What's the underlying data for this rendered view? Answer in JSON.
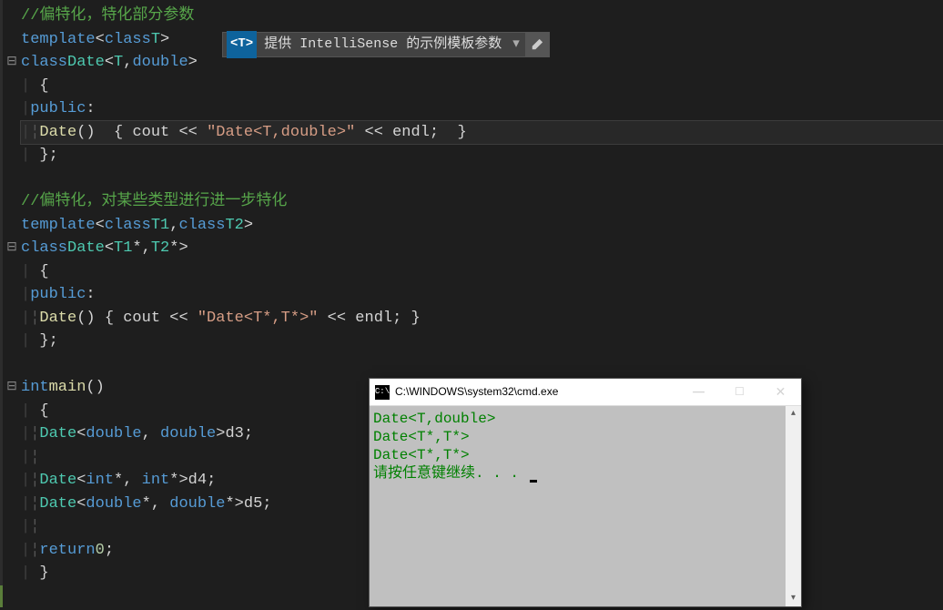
{
  "code": {
    "comment1": "//偏特化，特化部分参数",
    "l2_template": "template",
    "l2_class": "class",
    "l2_T": "T",
    "l3_class": "class",
    "l3_Date": "Date",
    "l3_T": "T",
    "l3_double": "double",
    "l5_public": "public",
    "l6_Date": "Date",
    "l6_cout": "cout",
    "l6_str": "\"Date<T,double>\"",
    "l6_endl": "endl",
    "comment2": "//偏特化，对某些类型进行进一步特化",
    "l10_template": "template",
    "l10_class": "class",
    "l10_T1": "T1",
    "l10_T2": "T2",
    "l11_class": "class",
    "l11_Date": "Date",
    "l11_T1": "T1",
    "l11_T2": "T2",
    "l13_public": "public",
    "l14_Date": "Date",
    "l14_cout": "cout",
    "l14_str": "\"Date<T*,T*>\"",
    "l14_endl": "endl",
    "l17_int": "int",
    "l17_main": "main",
    "l19_Date": "Date",
    "l19_double1": "double",
    "l19_double2": "double",
    "l19_d3": "d3",
    "l21_Date": "Date",
    "l21_int1": "int",
    "l21_int2": "int",
    "l21_d4": "d4",
    "l22_Date": "Date",
    "l22_double1": "double",
    "l22_double2": "double",
    "l22_d5": "d5",
    "l24_return": "return",
    "l24_zero": "0"
  },
  "intellisense": {
    "badge": "<T>",
    "text": "提供 IntelliSense 的示例模板参数",
    "dropdown": "▾"
  },
  "cmd": {
    "icon": "C:\\",
    "title": "C:\\WINDOWS\\system32\\cmd.exe",
    "line1": "Date<T,double>",
    "line2": "Date<T*,T*>",
    "line3": "Date<T*,T*>",
    "line4": "请按任意键继续. . . "
  }
}
